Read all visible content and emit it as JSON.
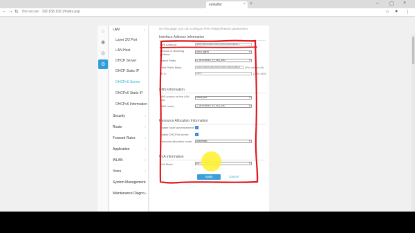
{
  "browser": {
    "tab_title": "edslaflet",
    "tab_close": "×",
    "new_tab": "+",
    "window_controls": [
      "–",
      "▢",
      "×"
    ],
    "nav_back": "←",
    "nav_forward": "→",
    "nav_reload": "↻",
    "security_label": "Not secure",
    "url": "192.168.100.1/index.asp",
    "toolbar_icons": [
      "star-icon",
      "profile-icon",
      "menu-icon"
    ]
  },
  "sidebar": {
    "group_lan": "LAN",
    "items": [
      {
        "label": "Layer 2/3 Port",
        "active": false
      },
      {
        "label": "LAN Host",
        "active": false
      },
      {
        "label": "DHCP Server",
        "active": false
      },
      {
        "label": "DHCP Static IP",
        "active": false
      },
      {
        "label": "DHCPv6 Server",
        "active": true
      },
      {
        "label": "DHCPv6 Static IP",
        "active": false
      },
      {
        "label": "DHCPv6 Information",
        "active": false
      }
    ],
    "groups": [
      {
        "label": "Security"
      },
      {
        "label": "Route"
      },
      {
        "label": "Forward Rules"
      },
      {
        "label": "Application"
      },
      {
        "label": "WLAN"
      },
      {
        "label": "Voice"
      },
      {
        "label": "System Management"
      },
      {
        "label": "Maintenance Diagno..."
      }
    ],
    "chevron": "›",
    "expanded_chevron": "⌄"
  },
  "main": {
    "hint": "On this page, you can configure IPv6 related feature parameters.",
    "interface_section": "Interface Address Information",
    "ipv6_address_label": "IPv6 Address:",
    "ipv6_address_value": "fe80:0000:0000:0000:0000:0000:0000:1",
    "method_label": "Method of obtaining prefixes:",
    "method_value": "WAN agent",
    "parent_prefix_label": "Parent Prefix:",
    "parent_prefix_value": "1_INTERNET_R_VID_100",
    "child_prefix_label": "Child Prefix Mask:",
    "child_prefix_value": "0000:0000:0000:0000:0000:0000:0000:0",
    "child_prefix_note": "(IPv6 address 64)",
    "mtu_label": "MTU:",
    "mtu_value": "1472",
    "mtu_note": "(1280-1500)",
    "dns_section": "DNS Information",
    "dns_source_label": "DNS source on the LAN side:",
    "dns_source_value": "WAN port",
    "wan_name_label": "WAN name:",
    "wan_name_value": "1_INTERNET_R_VID_100",
    "resource_section": "Resource Allocation Information",
    "route_ad_label": "Enable route advertisement:",
    "dhcpv6_server_label": "Enable DHCPv6 server:",
    "resource_mode_label": "Resource allocation mode:",
    "resource_mode_value": "Automatic",
    "ula_section": "ULA information",
    "ula_mode_label": "ULA Mode:",
    "ula_mode_value": "Di...",
    "checkmark": "✓",
    "dropdown_arrow": "▾",
    "apply_label": "Apply",
    "cancel_label": "Cancel"
  },
  "annotation": {
    "stroke_color": "#e0161b"
  },
  "cursor_highlight": {
    "color": "#fff028"
  }
}
